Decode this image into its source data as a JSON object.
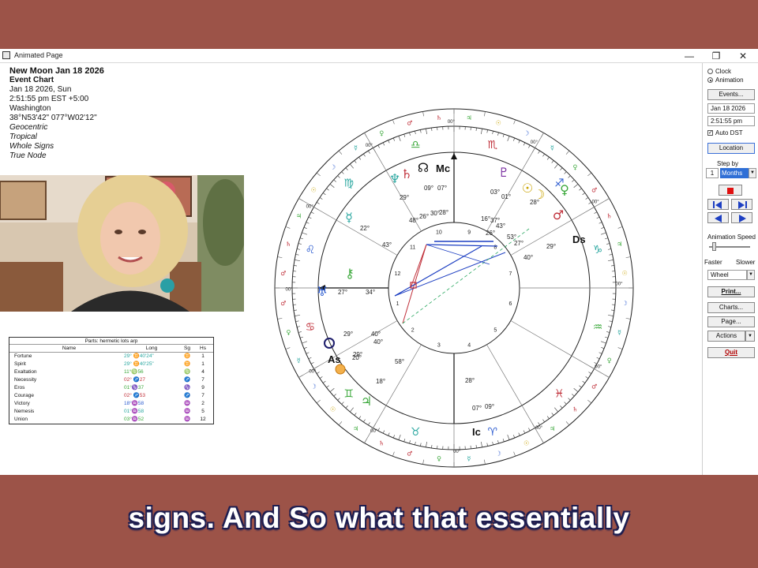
{
  "window": {
    "title": "Animated Page",
    "min_label": "—",
    "max_label": "❐",
    "close_label": "✕"
  },
  "chart_info": {
    "title": "New Moon Jan 18 2026",
    "type": "Event Chart",
    "date": "Jan 18 2026, Sun",
    "time": "2:51:55 pm  EST +5:00",
    "place": "Washington",
    "coords": "38°N53'42\" 077°W02'12\"",
    "options": [
      "Geocentric",
      "Tropical",
      "Whole Signs",
      "True Node"
    ]
  },
  "parts_table": {
    "caption": "Parts: hermetic lots arp",
    "headers": [
      "Name",
      "Long",
      "Sg",
      "Hs"
    ],
    "rows": [
      {
        "name": "Fortune",
        "long": "29° ♊40'24\"",
        "sg": "♊",
        "hs": "1",
        "color": "#2aa7a0"
      },
      {
        "name": "Spirit",
        "long": "29° ♊40'25\"",
        "sg": "♊",
        "hs": "1",
        "color": "#2aa7a0"
      },
      {
        "name": "Exaltation",
        "long": "11°♍56",
        "sg": "♍",
        "hs": "4",
        "color": "#3aa83a"
      },
      {
        "name": "Necessity",
        "long": "02° ♐27",
        "sg": "♐",
        "hs": "7",
        "color": "#c0303a"
      },
      {
        "name": "Eros",
        "long": "01°♑37",
        "sg": "♑",
        "hs": "9",
        "color": "#3aa83a"
      },
      {
        "name": "Courage",
        "long": "02° ♐53",
        "sg": "♐",
        "hs": "7",
        "color": "#c0303a"
      },
      {
        "name": "Victory",
        "long": "18°♒58",
        "sg": "♒",
        "hs": "2",
        "color": "#2d5cd0"
      },
      {
        "name": "Nemesis",
        "long": "01°♒58",
        "sg": "♒",
        "hs": "5",
        "color": "#2aa7a0"
      },
      {
        "name": "Union",
        "long": "03°♒52",
        "sg": "♒",
        "hs": "12",
        "color": "#3aa83a"
      }
    ]
  },
  "panel": {
    "clock_label": "Clock",
    "animation_label": "Animation",
    "events_label": "Events...",
    "date_value": "Jan 18 2026",
    "time_value": "2:51:55 pm",
    "auto_dst_label": "Auto DST",
    "location_label": "Location",
    "step_by_label": "Step by",
    "step_value": "1",
    "step_unit": "Months",
    "anim_speed_label": "Animation Speed",
    "faster_label": "Faster",
    "slower_label": "Slower",
    "display_value": "Wheel",
    "print_label": "Print...",
    "charts_label": "Charts...",
    "page_label": "Page...",
    "actions_label": "Actions",
    "quit_label": "Quit"
  },
  "wheel": {
    "house_numbers": [
      "1",
      "2",
      "3",
      "4",
      "5",
      "6",
      "7",
      "8",
      "9",
      "10",
      "11",
      "12"
    ],
    "angles": [
      "As",
      "Ds",
      "Mc",
      "Ic"
    ],
    "sign_glyphs": [
      "♈",
      "♉",
      "♊",
      "♋",
      "♌",
      "♍",
      "♎",
      "♏",
      "♐",
      "♑",
      "♒",
      "♓"
    ],
    "degree_marker": "00°",
    "planet_labels": [
      {
        "text": "♆",
        "color": "#2aa7a0"
      },
      {
        "text": "♄",
        "color": "#c0303a"
      },
      {
        "text": "☊",
        "color": "#111"
      },
      {
        "text": "♇",
        "color": "#7a2fa0"
      },
      {
        "text": "☉",
        "color": "#c9a300"
      },
      {
        "text": "☽",
        "color": "#c9a300"
      },
      {
        "text": "♀",
        "color": "#3aa83a"
      },
      {
        "text": "♂",
        "color": "#c0303a"
      },
      {
        "text": "☿",
        "color": "#2aa7a0"
      },
      {
        "text": "⚷",
        "color": "#3aa83a"
      },
      {
        "text": "♅",
        "color": "#2d5cd0"
      },
      {
        "text": "♃",
        "color": "#3aa83a"
      }
    ],
    "degree_labels": [
      "29°",
      "09°",
      "07°",
      "48°",
      "26°",
      "30°",
      "28°",
      "03°",
      "01°",
      "28°",
      "16°",
      "37°",
      "43°",
      "53°",
      "27°",
      "40°",
      "29°",
      "22°",
      "43°",
      "27°",
      "34°",
      "29°",
      "40°",
      "20°",
      "40°",
      "29°",
      "58°",
      "18°",
      "28°",
      "07°",
      "09°",
      "26°"
    ]
  },
  "subtitle": "signs. And So what that essentially"
}
